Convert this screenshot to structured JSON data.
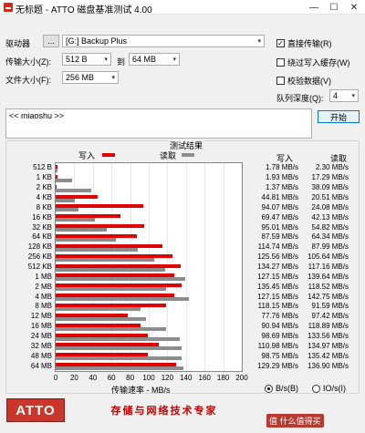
{
  "window": {
    "title": "无标题 - ATTO 磁盘基准测试 4.00",
    "minimize_glyph": "—",
    "maximize_glyph": "☐",
    "close_glyph": "✕"
  },
  "form": {
    "drive_label": "驱动器",
    "browse_label": "...",
    "drive_value": "[G:] Backup Plus",
    "transfer_size_label": "传输大小(Z):",
    "transfer_from": "512 B",
    "to_label": "到",
    "transfer_to": "64 MB",
    "file_size_label": "文件大小(F):",
    "file_size": "256 MB",
    "direct_io_label": "直接传输(R)",
    "direct_io_checked": true,
    "bypass_cache_label": "绕过写入缓存(W)",
    "bypass_cache_checked": false,
    "verify_label": "校验数据(V)",
    "verify_checked": false,
    "queue_depth_label": "队列深度(Q):",
    "queue_depth": "4",
    "description": "<< miaoshu >>",
    "start_label": "开始",
    "check_mark": "✓",
    "dropdown_arrow": "▾"
  },
  "results": {
    "title": "测试结果",
    "write_legend": "写入",
    "read_legend": "读取",
    "write_header": "写入",
    "read_header": "读取",
    "xlabel": "传输速率 - MB/s",
    "write_color": "#e30000",
    "read_color": "#8c8c8c"
  },
  "chart_data": {
    "type": "bar",
    "xlim": [
      0,
      200
    ],
    "xticks": [
      "0",
      "20",
      "40",
      "60",
      "80",
      "100",
      "120",
      "140",
      "160",
      "180",
      "200"
    ],
    "categories": [
      "512 B",
      "1 KB",
      "2 KB",
      "4 KB",
      "8 KB",
      "16 KB",
      "32 KB",
      "64 KB",
      "128 KB",
      "256 KB",
      "512 KB",
      "1 MB",
      "2 MB",
      "4 MB",
      "8 MB",
      "12 MB",
      "16 MB",
      "24 MB",
      "32 MB",
      "48 MB",
      "64 MB"
    ],
    "series": [
      {
        "name": "写入",
        "values": [
          1.78,
          1.93,
          1.37,
          44.81,
          94.07,
          69.47,
          95.01,
          87.59,
          114.74,
          125.56,
          134.27,
          127.15,
          135.45,
          127.15,
          118.15,
          77.76,
          90.94,
          98.69,
          110.98,
          98.75,
          129.29
        ]
      },
      {
        "name": "读取",
        "values": [
          2.3,
          17.29,
          38.09,
          20.51,
          24.08,
          42.13,
          54.82,
          64.34,
          87.99,
          105.64,
          117.16,
          139.64,
          118.52,
          142.75,
          91.59,
          97.42,
          118.89,
          133.56,
          134.97,
          135.42,
          136.9
        ]
      }
    ],
    "write_labels": [
      "1.78 MB/s",
      "1.93 MB/s",
      "1.37 MB/s",
      "44.81 MB/s",
      "94.07 MB/s",
      "69.47 MB/s",
      "95.01 MB/s",
      "87.59 MB/s",
      "114.74 MB/s",
      "125.56 MB/s",
      "134.27 MB/s",
      "127.15 MB/s",
      "135.45 MB/s",
      "127.15 MB/s",
      "118.15 MB/s",
      "77.76 MB/s",
      "90.94 MB/s",
      "98.69 MB/s",
      "110.98 MB/s",
      "98.75 MB/s",
      "129.29 MB/s"
    ],
    "read_labels": [
      "2.30 MB/s",
      "17.29 MB/s",
      "38.09 MB/s",
      "20.51 MB/s",
      "24.08 MB/s",
      "42.13 MB/s",
      "54.82 MB/s",
      "64.34 MB/s",
      "87.99 MB/s",
      "105.64 MB/s",
      "117.16 MB/s",
      "139.64 MB/s",
      "118.52 MB/s",
      "142.75 MB/s",
      "91.59 MB/s",
      "97.42 MB/s",
      "118.89 MB/s",
      "133.56 MB/s",
      "134.97 MB/s",
      "135.42 MB/s",
      "136.90 MB/s"
    ]
  },
  "footer": {
    "logo": "ATTO",
    "banner": "存储与网络技术专家",
    "unit_bytes_label": "B/s(B)",
    "unit_bytes_selected": true,
    "unit_io_label": "IO/s(I)",
    "unit_io_selected": false,
    "watermark": "值 什么值得买"
  }
}
